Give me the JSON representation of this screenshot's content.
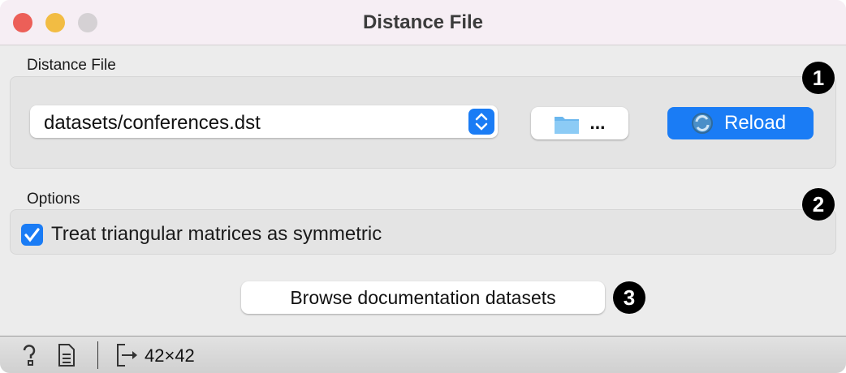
{
  "window": {
    "title": "Distance File"
  },
  "file_section": {
    "label": "Distance File",
    "selected_file": "datasets/conferences.dst",
    "browse_label": "...",
    "reload_label": "Reload"
  },
  "options_section": {
    "label": "Options",
    "symmetric_checkbox": {
      "label": "Treat triangular matrices as symmetric",
      "checked": true
    }
  },
  "docs_button": {
    "label": "Browse documentation datasets"
  },
  "markers": [
    "1",
    "2",
    "3"
  ],
  "status_bar": {
    "output_summary": "42×42"
  },
  "colors": {
    "accent": "#1a7cf5"
  }
}
